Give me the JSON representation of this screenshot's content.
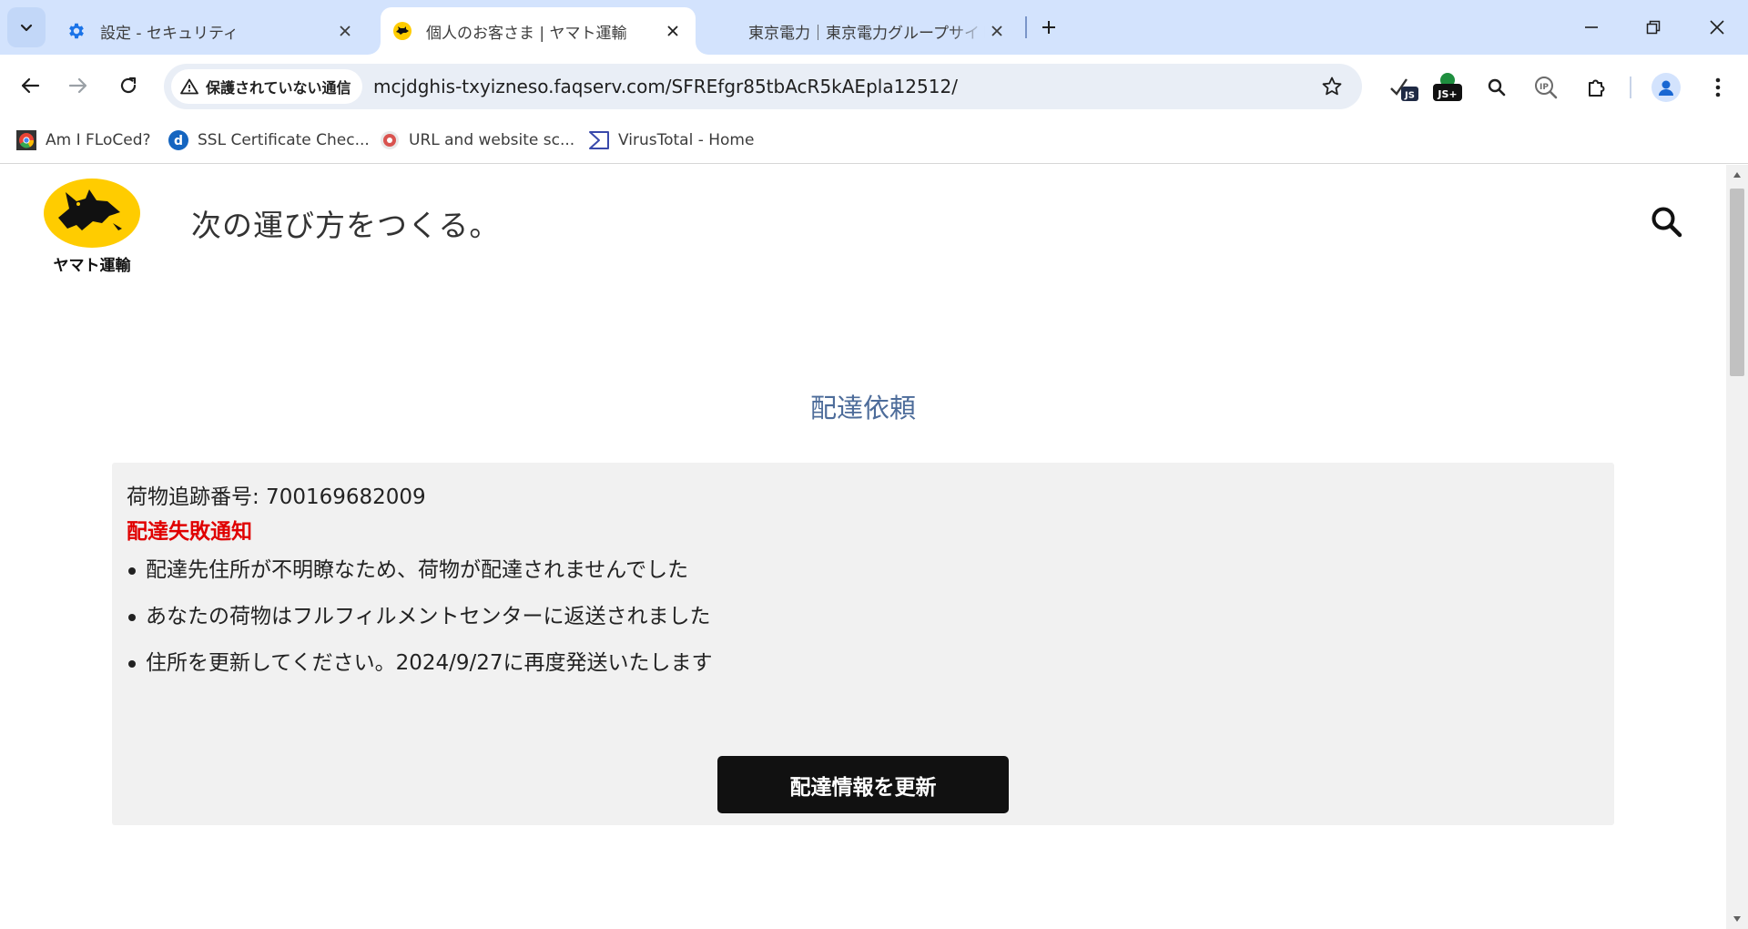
{
  "browser": {
    "tabs": [
      {
        "title": "設定 - セキュリティ",
        "icon": "gear-icon",
        "active": false
      },
      {
        "title": "個人のお客さま | ヤマト運輸",
        "icon": "yamato-cat-favicon",
        "active": true
      },
      {
        "title": "東京電力｜東京電力グループサイト",
        "icon": "none",
        "active": false
      }
    ],
    "address_bar": {
      "security_label": "保護されていない通信",
      "url": "mcjdghis-txyizneso.faqserv.com/SFREfgr85tbAcR5kAEpla12512/"
    },
    "extensions": [
      {
        "name": "js-toggle-icon",
        "label": "JS"
      },
      {
        "name": "js-plus-icon",
        "label": "JS+"
      },
      {
        "name": "search-extension-icon"
      },
      {
        "name": "ip-lookup-icon",
        "label": "IP"
      },
      {
        "name": "extensions-puzzle-icon"
      }
    ],
    "bookmarks": [
      {
        "label": "Am I FLoCed?"
      },
      {
        "label": "SSL Certificate Chec..."
      },
      {
        "label": "URL and website sc..."
      },
      {
        "label": "VirusTotal - Home"
      }
    ]
  },
  "page": {
    "logo_text": "ヤマト運輸",
    "tagline": "次の運び方をつくる。",
    "section_title": "配達依頼",
    "tracking_label": "荷物追跡番号: 700169682009",
    "failure_title": "配達失敗通知",
    "notice_items": [
      "配達先住所が不明瞭なため、荷物が配達されませんでした",
      "あなたの荷物はフルフィルメントセンターに返送されました",
      "住所を更新してください。2024/9/27に再度発送いたします"
    ],
    "update_button": "配達情報を更新"
  },
  "colors": {
    "tabstrip": "#d3e3fd",
    "section_title": "#4d6c9a",
    "failure_red": "#e00000",
    "notice_bg": "#f1f1f1",
    "button_bg": "#111111",
    "logo_yellow": "#ffcc00"
  }
}
